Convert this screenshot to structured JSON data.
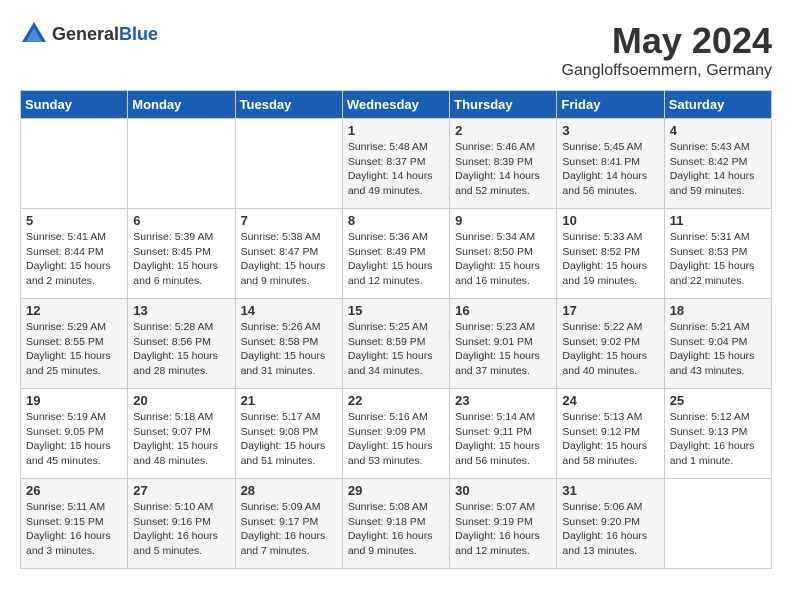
{
  "logo": {
    "general": "General",
    "blue": "Blue"
  },
  "title": {
    "month_year": "May 2024",
    "location": "Gangloffsoemmern, Germany"
  },
  "headers": [
    "Sunday",
    "Monday",
    "Tuesday",
    "Wednesday",
    "Thursday",
    "Friday",
    "Saturday"
  ],
  "weeks": [
    {
      "days": [
        {
          "num": "",
          "info": ""
        },
        {
          "num": "",
          "info": ""
        },
        {
          "num": "",
          "info": ""
        },
        {
          "num": "1",
          "info": "Sunrise: 5:48 AM\nSunset: 8:37 PM\nDaylight: 14 hours\nand 49 minutes."
        },
        {
          "num": "2",
          "info": "Sunrise: 5:46 AM\nSunset: 8:39 PM\nDaylight: 14 hours\nand 52 minutes."
        },
        {
          "num": "3",
          "info": "Sunrise: 5:45 AM\nSunset: 8:41 PM\nDaylight: 14 hours\nand 56 minutes."
        },
        {
          "num": "4",
          "info": "Sunrise: 5:43 AM\nSunset: 8:42 PM\nDaylight: 14 hours\nand 59 minutes."
        }
      ]
    },
    {
      "days": [
        {
          "num": "5",
          "info": "Sunrise: 5:41 AM\nSunset: 8:44 PM\nDaylight: 15 hours\nand 2 minutes."
        },
        {
          "num": "6",
          "info": "Sunrise: 5:39 AM\nSunset: 8:45 PM\nDaylight: 15 hours\nand 6 minutes."
        },
        {
          "num": "7",
          "info": "Sunrise: 5:38 AM\nSunset: 8:47 PM\nDaylight: 15 hours\nand 9 minutes."
        },
        {
          "num": "8",
          "info": "Sunrise: 5:36 AM\nSunset: 8:49 PM\nDaylight: 15 hours\nand 12 minutes."
        },
        {
          "num": "9",
          "info": "Sunrise: 5:34 AM\nSunset: 8:50 PM\nDaylight: 15 hours\nand 16 minutes."
        },
        {
          "num": "10",
          "info": "Sunrise: 5:33 AM\nSunset: 8:52 PM\nDaylight: 15 hours\nand 19 minutes."
        },
        {
          "num": "11",
          "info": "Sunrise: 5:31 AM\nSunset: 8:53 PM\nDaylight: 15 hours\nand 22 minutes."
        }
      ]
    },
    {
      "days": [
        {
          "num": "12",
          "info": "Sunrise: 5:29 AM\nSunset: 8:55 PM\nDaylight: 15 hours\nand 25 minutes."
        },
        {
          "num": "13",
          "info": "Sunrise: 5:28 AM\nSunset: 8:56 PM\nDaylight: 15 hours\nand 28 minutes."
        },
        {
          "num": "14",
          "info": "Sunrise: 5:26 AM\nSunset: 8:58 PM\nDaylight: 15 hours\nand 31 minutes."
        },
        {
          "num": "15",
          "info": "Sunrise: 5:25 AM\nSunset: 8:59 PM\nDaylight: 15 hours\nand 34 minutes."
        },
        {
          "num": "16",
          "info": "Sunrise: 5:23 AM\nSunset: 9:01 PM\nDaylight: 15 hours\nand 37 minutes."
        },
        {
          "num": "17",
          "info": "Sunrise: 5:22 AM\nSunset: 9:02 PM\nDaylight: 15 hours\nand 40 minutes."
        },
        {
          "num": "18",
          "info": "Sunrise: 5:21 AM\nSunset: 9:04 PM\nDaylight: 15 hours\nand 43 minutes."
        }
      ]
    },
    {
      "days": [
        {
          "num": "19",
          "info": "Sunrise: 5:19 AM\nSunset: 9:05 PM\nDaylight: 15 hours\nand 45 minutes."
        },
        {
          "num": "20",
          "info": "Sunrise: 5:18 AM\nSunset: 9:07 PM\nDaylight: 15 hours\nand 48 minutes."
        },
        {
          "num": "21",
          "info": "Sunrise: 5:17 AM\nSunset: 9:08 PM\nDaylight: 15 hours\nand 51 minutes."
        },
        {
          "num": "22",
          "info": "Sunrise: 5:16 AM\nSunset: 9:09 PM\nDaylight: 15 hours\nand 53 minutes."
        },
        {
          "num": "23",
          "info": "Sunrise: 5:14 AM\nSunset: 9:11 PM\nDaylight: 15 hours\nand 56 minutes."
        },
        {
          "num": "24",
          "info": "Sunrise: 5:13 AM\nSunset: 9:12 PM\nDaylight: 15 hours\nand 58 minutes."
        },
        {
          "num": "25",
          "info": "Sunrise: 5:12 AM\nSunset: 9:13 PM\nDaylight: 16 hours\nand 1 minute."
        }
      ]
    },
    {
      "days": [
        {
          "num": "26",
          "info": "Sunrise: 5:11 AM\nSunset: 9:15 PM\nDaylight: 16 hours\nand 3 minutes."
        },
        {
          "num": "27",
          "info": "Sunrise: 5:10 AM\nSunset: 9:16 PM\nDaylight: 16 hours\nand 5 minutes."
        },
        {
          "num": "28",
          "info": "Sunrise: 5:09 AM\nSunset: 9:17 PM\nDaylight: 16 hours\nand 7 minutes."
        },
        {
          "num": "29",
          "info": "Sunrise: 5:08 AM\nSunset: 9:18 PM\nDaylight: 16 hours\nand 9 minutes."
        },
        {
          "num": "30",
          "info": "Sunrise: 5:07 AM\nSunset: 9:19 PM\nDaylight: 16 hours\nand 12 minutes."
        },
        {
          "num": "31",
          "info": "Sunrise: 5:06 AM\nSunset: 9:20 PM\nDaylight: 16 hours\nand 13 minutes."
        },
        {
          "num": "",
          "info": ""
        }
      ]
    }
  ]
}
